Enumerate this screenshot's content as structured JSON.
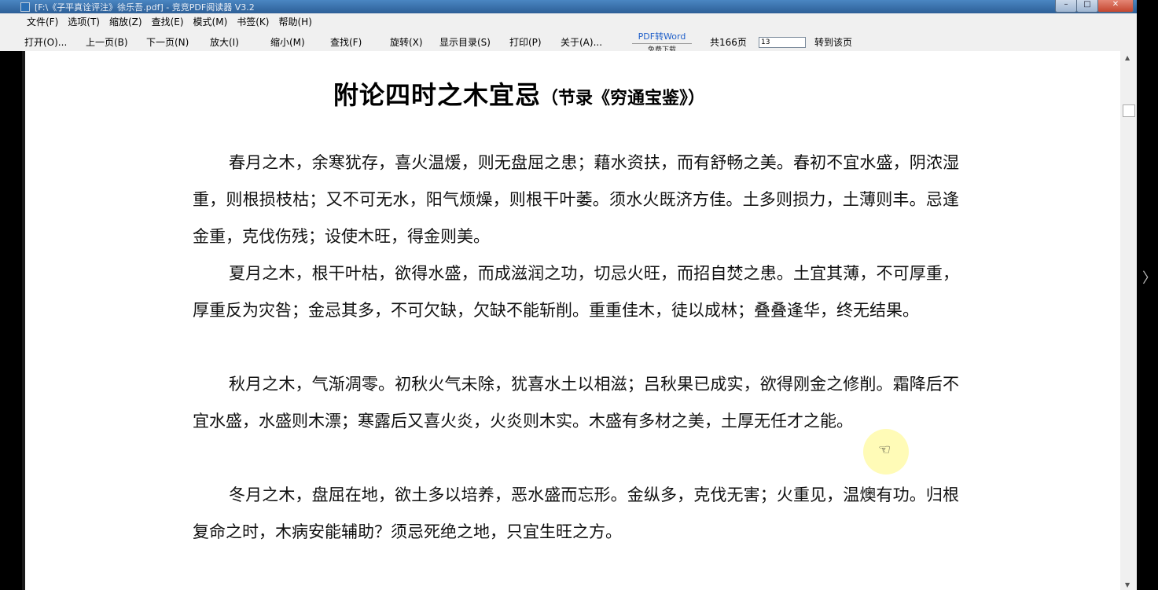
{
  "window": {
    "title": "[F:\\《子平真诠评注》徐乐吾.pdf] - 竞竞PDF阅读器 V3.2",
    "minimize": "–",
    "maximize": "□",
    "close": "✕"
  },
  "menu": [
    "文件(F)",
    "选项(T)",
    "缩放(Z)",
    "查找(E)",
    "模式(M)",
    "书签(K)",
    "帮助(H)"
  ],
  "toolbar": {
    "open": "打开(O)...",
    "prev": "上一页(B)",
    "next": "下一页(N)",
    "zoom_in": "放大(I)",
    "zoom_out": "缩小(M)",
    "find": "查找(F)",
    "rotate": "旋转(X)",
    "toc": "显示目录(S)",
    "print": "打印(P)",
    "about": "关于(A)...",
    "pdf_word": "PDF转Word",
    "free_download": "免费下载",
    "total_pages": "共166页",
    "page_value": "13",
    "goto": "转到该页"
  },
  "document": {
    "title": "附论四时之木宜忌",
    "subtitle": "（节录《穷通宝鉴》）",
    "paragraphs": [
      "春月之木，余寒犹存，喜火温煖，则无盘屈之患；藉水资扶，而有舒畅之美。春初不宜水盛，阴浓湿重，则根损枝枯；又不可无水，阳气烦燥，则根干叶萎。须水火既济方佳。土多则损力，土薄则丰。忌逢金重，克伐伤残；设使木旺，得金则美。",
      "夏月之木，根干叶枯，欲得水盛，而成滋润之功，切忌火旺，而招自焚之患。土宜其薄，不可厚重，厚重反为灾咎；金忌其多，不可欠缺，欠缺不能斩削。重重佳木，徒以成林；叠叠逢华，终无结果。",
      "秋月之木，气渐凋零。初秋火气未除，犹喜水土以相滋；吕秋果已成实，欲得刚金之修削。霜降后不宜水盛，水盛则木漂；寒露后又喜火炎，火炎则木实。木盛有多材之美，土厚无任才之能。",
      "冬月之木，盘屈在地，欲土多以培养，恶水盛而忘形。金纵多，克伐无害；火重见，温燠有功。归根复命之时，木病安能辅助？须忌死绝之地，只宜生旺之方。"
    ]
  },
  "icons": {
    "cursor": "hand-cursor-icon",
    "scroll_up": "scroll-up-arrow-icon",
    "scroll_down": "scroll-down-arrow-icon",
    "side_chevron": "chevron-right-icon"
  },
  "glyphs": {
    "hand": "☜",
    "up": "▲",
    "down": "▼",
    "chevron": "〉"
  }
}
